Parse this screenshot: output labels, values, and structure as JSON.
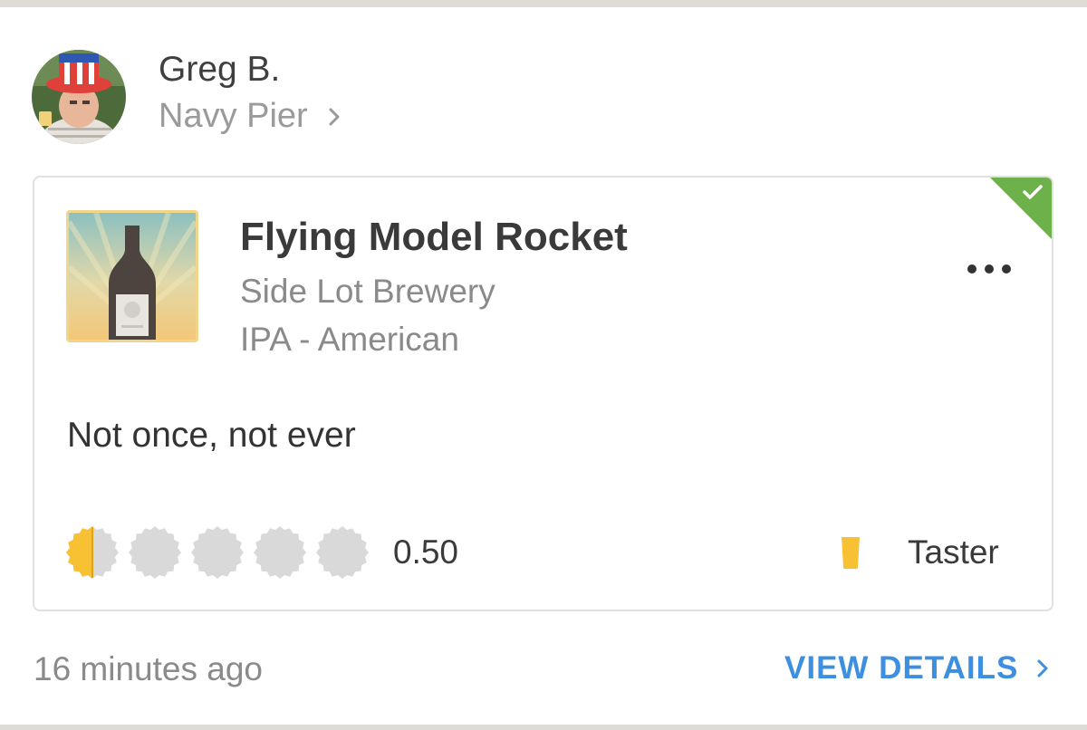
{
  "checkin": {
    "user": {
      "name": "Greg B.",
      "venue": "Navy Pier"
    },
    "beer": {
      "name": "Flying Model Rocket",
      "brewery": "Side Lot Brewery",
      "style": "IPA - American"
    },
    "comment": "Not once, not ever",
    "rating": {
      "value": 0.5,
      "max": 5,
      "display": "0.50"
    },
    "serving": {
      "label": "Taster",
      "icon": "taster-glass-icon"
    },
    "verified": true,
    "timestamp": "16 minutes ago",
    "view_details_label": "VIEW DETAILS"
  },
  "colors": {
    "accent_link": "#3d8fe0",
    "rating_fill": "#f8c133",
    "rating_empty": "#d9d9d9",
    "verified_flag": "#6cb14a"
  },
  "icons": {
    "more": "more-dots-icon",
    "chevron": "chevron-right-icon",
    "verified": "checkmark-icon",
    "rating": "bottle-cap-icon"
  }
}
